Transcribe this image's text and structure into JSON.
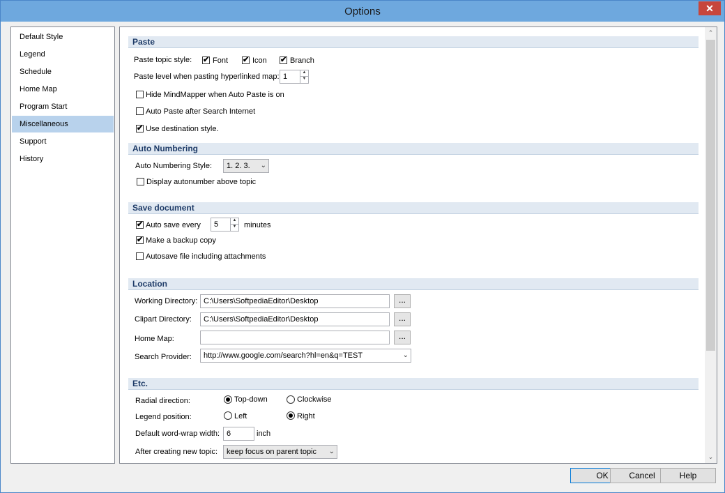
{
  "window": {
    "title": "Options",
    "close_glyph": "✕"
  },
  "nav": {
    "items": [
      "Default Style",
      "Legend",
      "Schedule",
      "Home Map",
      "Program Start",
      "Miscellaneous",
      "Support",
      "History"
    ],
    "selected": "Miscellaneous"
  },
  "paste": {
    "header": "Paste",
    "topic_style_label": "Paste topic style:",
    "font_label": "Font",
    "font_checked": true,
    "icon_label": "Icon",
    "icon_checked": true,
    "branch_label": "Branch",
    "branch_checked": true,
    "level_label": "Paste level when pasting hyperlinked map:",
    "level_value": "1",
    "hide_label": "Hide MindMapper when Auto Paste is on",
    "hide_checked": false,
    "auto_paste_label": "Auto Paste after Search Internet",
    "auto_paste_checked": false,
    "dest_style_label": "Use destination style.",
    "dest_style_checked": true
  },
  "auto_numbering": {
    "header": "Auto Numbering",
    "style_label": "Auto Numbering Style:",
    "style_value": "1. 2. 3.",
    "display_label": "Display autonumber above topic",
    "display_checked": false
  },
  "save": {
    "header": "Save document",
    "auto_save_label": "Auto save every",
    "auto_save_checked": true,
    "interval_value": "5",
    "minutes_label": "minutes",
    "backup_label": "Make a backup copy",
    "backup_checked": true,
    "attachments_label": "Autosave file including attachments",
    "attachments_checked": false
  },
  "location": {
    "header": "Location",
    "working_label": "Working Directory:",
    "working_value": "C:\\Users\\SoftpediaEditor\\Desktop",
    "clipart_label": "Clipart Directory:",
    "clipart_value": "C:\\Users\\SoftpediaEditor\\Desktop",
    "homemap_label": "Home Map:",
    "homemap_value": "",
    "provider_label": "Search Provider:",
    "provider_value": "http://www.google.com/search?hl=en&q=TEST",
    "browse_label": "..."
  },
  "etc": {
    "header": "Etc.",
    "radial_label": "Radial direction:",
    "radial_options": [
      "Top-down",
      "Clockwise"
    ],
    "radial_selected": "Top-down",
    "legend_label": "Legend position:",
    "legend_options": [
      "Left",
      "Right"
    ],
    "legend_selected": "Right",
    "wrap_label": "Default word-wrap width:",
    "wrap_value": "6",
    "wrap_unit": "inch",
    "after_label": "After creating new topic:",
    "after_value": "keep focus on parent topic"
  },
  "icons": {
    "check": "✔",
    "spin_up": "▲",
    "spin_down": "▼",
    "dropdown": "⌄",
    "scroll_up": "⌃",
    "scroll_down": "⌄"
  },
  "buttons": {
    "ok": "OK",
    "cancel": "Cancel",
    "help": "Help"
  }
}
